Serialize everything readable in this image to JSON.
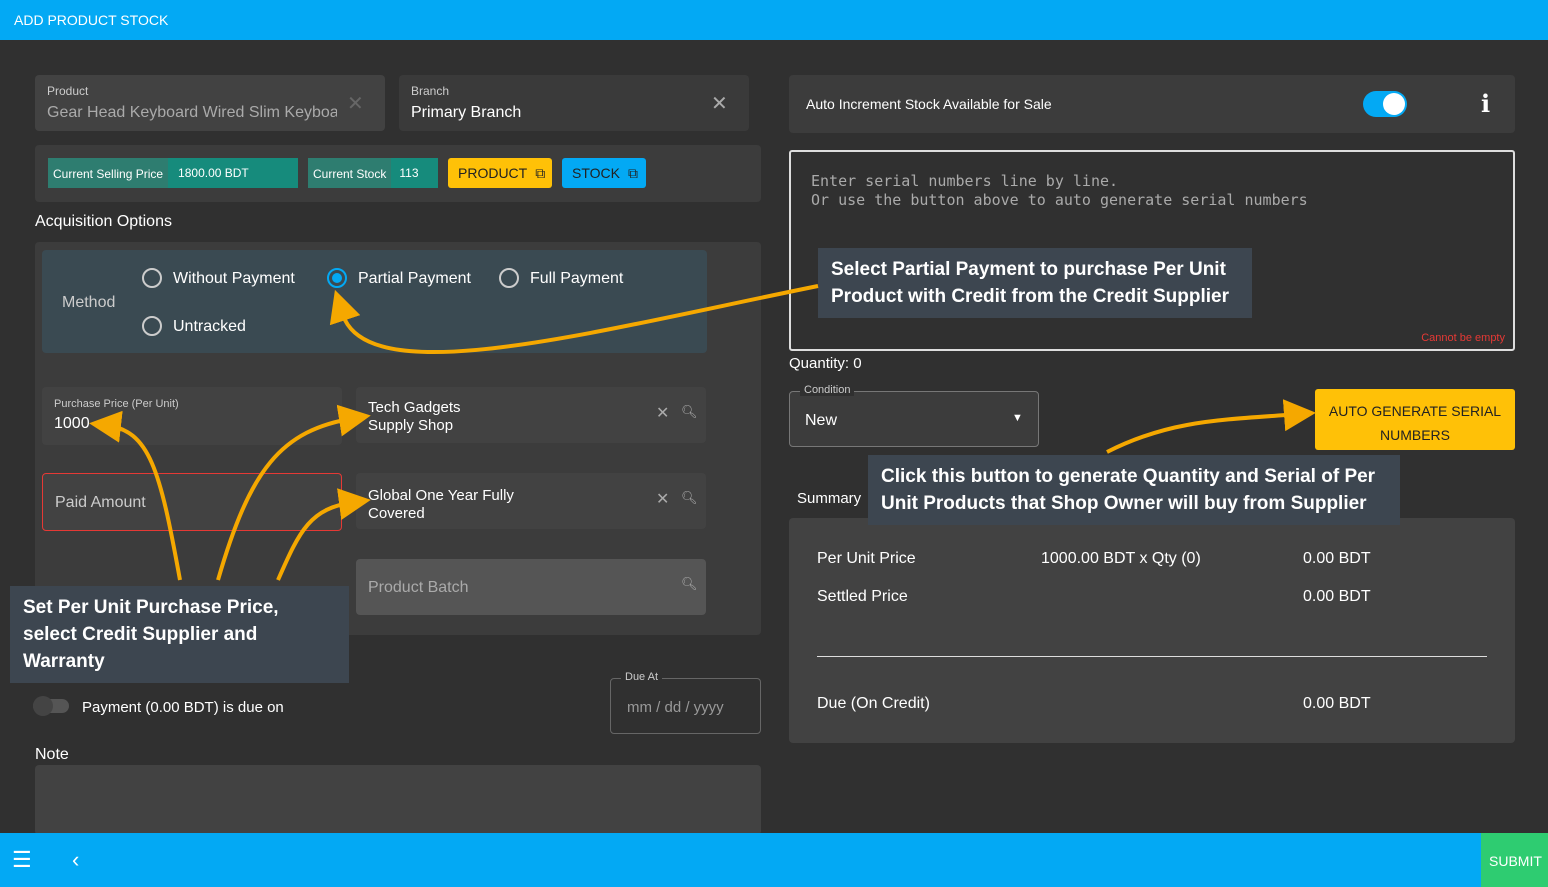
{
  "header": {
    "title": "ADD PRODUCT STOCK"
  },
  "product": {
    "label": "Product",
    "value": "Gear Head Keyboard Wired Slim Keyboard"
  },
  "branch": {
    "label": "Branch",
    "value": "Primary Branch"
  },
  "info": {
    "selling_price_label": "Current Selling Price",
    "selling_price": "1800.00 BDT",
    "stock_label": "Current Stock",
    "stock": "113",
    "product_btn": "PRODUCT",
    "stock_btn": "STOCK"
  },
  "acquisition": {
    "title": "Acquisition Options",
    "method_label": "Method",
    "options": [
      "Without Payment",
      "Partial Payment",
      "Full Payment",
      "Untracked"
    ],
    "selected": "Partial Payment"
  },
  "purchase_price": {
    "label": "Purchase Price (Per Unit)",
    "value": "1000"
  },
  "paid_amount": {
    "placeholder": "Paid Amount"
  },
  "supplier": {
    "value": "Tech Gadgets Supply Shop"
  },
  "warranty": {
    "value": "Global One Year Fully Covered"
  },
  "batch": {
    "placeholder": "Product Batch"
  },
  "payment_due": {
    "label": "Payment (0.00 BDT) is due on",
    "due_label": "Due At",
    "due_placeholder": "mm / dd / yyyy"
  },
  "note": {
    "label": "Note"
  },
  "auto_increment": {
    "label": "Auto Increment Stock Available for Sale",
    "enabled": true
  },
  "serials": {
    "placeholder": "Enter serial numbers line by line.\nOr use the button above to auto generate serial numbers",
    "error": "Cannot be empty"
  },
  "quantity": {
    "label": "Quantity: 0"
  },
  "condition": {
    "label": "Condition",
    "value": "New"
  },
  "auto_generate_btn": "AUTO GENERATE SERIAL NUMBERS",
  "summary": {
    "title": "Summary",
    "rows": [
      {
        "label": "Per Unit Price",
        "calc": "1000.00 BDT x Qty (0)",
        "value": "0.00 BDT"
      },
      {
        "label": "Settled Price",
        "calc": "",
        "value": "0.00 BDT"
      },
      {
        "label": "Due (On Credit)",
        "calc": "",
        "value": "0.00 BDT"
      }
    ]
  },
  "callouts": [
    "Select Partial Payment to purchase Per Unit Product with Credit from the Credit Supplier",
    "Click this button to generate Quantity and Serial of Per Unit Products that Shop Owner will buy from Supplier",
    "Set Per Unit Purchase Price, select Credit Supplier and Warranty"
  ],
  "footer": {
    "submit": "SUBMIT"
  },
  "colors": {
    "primary": "#03a9f4",
    "accent": "#ffc107",
    "teal": "#168b7c",
    "submit": "#2ecc71",
    "arrow": "#f5a800"
  }
}
